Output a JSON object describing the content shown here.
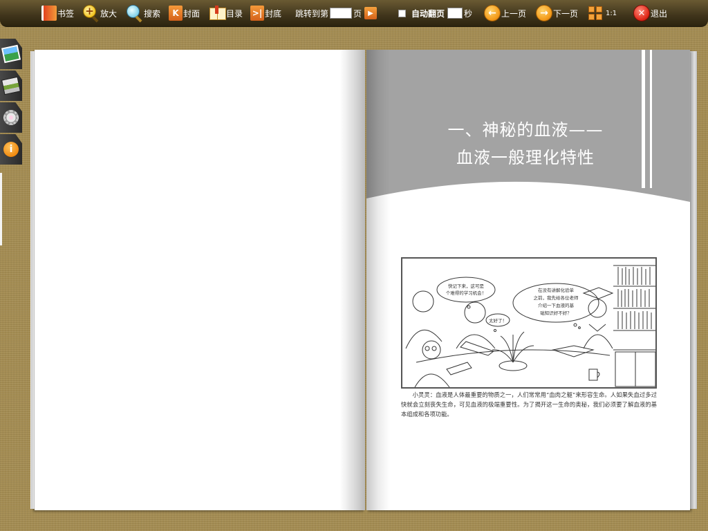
{
  "toolbar": {
    "bookmark": "书签",
    "zoom": "放大",
    "search": "搜索",
    "cover": "封面",
    "toc": "目录",
    "back_cover": "封底",
    "jump_prefix": "跳转到第",
    "jump_suffix": "页",
    "jump_value": "",
    "autoflip": "自动翻页",
    "autoflip_seconds_value": "",
    "seconds": "秒",
    "prev": "上一页",
    "next": "下一页",
    "ratio": "1:1",
    "exit": "退出"
  },
  "side_toolbar": {
    "icons": [
      "image-icon",
      "print-icon",
      "settings-gear-icon",
      "info-icon"
    ]
  },
  "book": {
    "left_page": {
      "content": ""
    },
    "right_page": {
      "title_line1": "一、神秘的血液——",
      "title_line2": "血液一般理化特性",
      "bubbles": {
        "b1_l1": "快记下来，这可是",
        "b1_l2": "个难得的学习机会！",
        "b2": "太好了！",
        "b3_l1": "在没有讲解化验单",
        "b3_l2": "之前，我先给各位老师",
        "b3_l3": "介绍一下血液的基",
        "b3_l4": "础知识好不好？"
      },
      "caption": "小灵灵：血液是人体最重要的物质之一，人们常常用“血肉之躯”来形容生命。人如果失血过多过快就会立刻丧失生命，可见血液的极端重要性。为了揭开这一生命的奥秘，我们必须要了解血液的基本组成和各项功能。"
    }
  },
  "colors": {
    "toolbar_bg": "#3f341b",
    "background": "#a48c52",
    "header_band": "#a3a3a3",
    "accent_orange": "#f39a1a"
  }
}
